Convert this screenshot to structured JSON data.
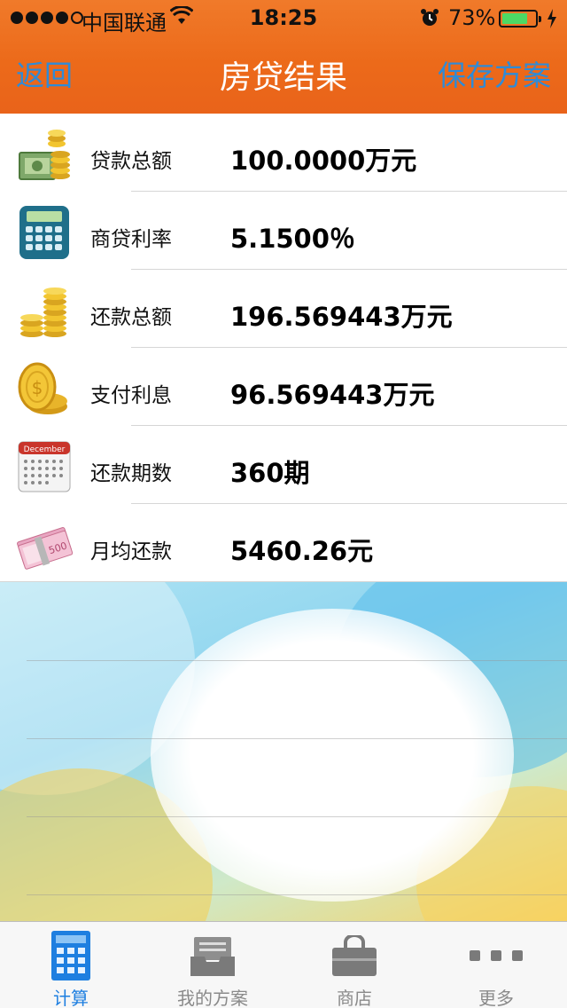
{
  "status": {
    "carrier": "中国联通",
    "time": "18:25",
    "battery": "73%"
  },
  "nav": {
    "back": "返回",
    "title": "房贷结果",
    "save": "保存方案"
  },
  "results": [
    {
      "icon": "money-stack-icon",
      "label": "贷款总额",
      "value": "100.0000万元"
    },
    {
      "icon": "calculator-icon",
      "label": "商贷利率",
      "value": "5.1500％"
    },
    {
      "icon": "coin-stack-icon",
      "label": "还款总额",
      "value": "196.569443万元"
    },
    {
      "icon": "gold-coins-icon",
      "label": "支付利息",
      "value": "96.569443万元"
    },
    {
      "icon": "calendar-icon",
      "label": "还款期数",
      "value": "360期"
    },
    {
      "icon": "banknotes-icon",
      "label": "月均还款",
      "value": "5460.26元"
    }
  ],
  "calendar_icon_text": "December",
  "tabs": [
    {
      "label": "计算",
      "icon": "calculator-tab-icon",
      "active": true
    },
    {
      "label": "我的方案",
      "icon": "inbox-tray-icon",
      "active": false
    },
    {
      "label": "商店",
      "icon": "shopping-bag-icon",
      "active": false
    },
    {
      "label": "更多",
      "icon": "more-dots-icon",
      "active": false
    }
  ],
  "colors": {
    "header": "#ec6a1a",
    "nav_link": "#2e8bd8",
    "tab_active": "#1e7fe0",
    "tab_inactive": "#8a8a8a"
  }
}
